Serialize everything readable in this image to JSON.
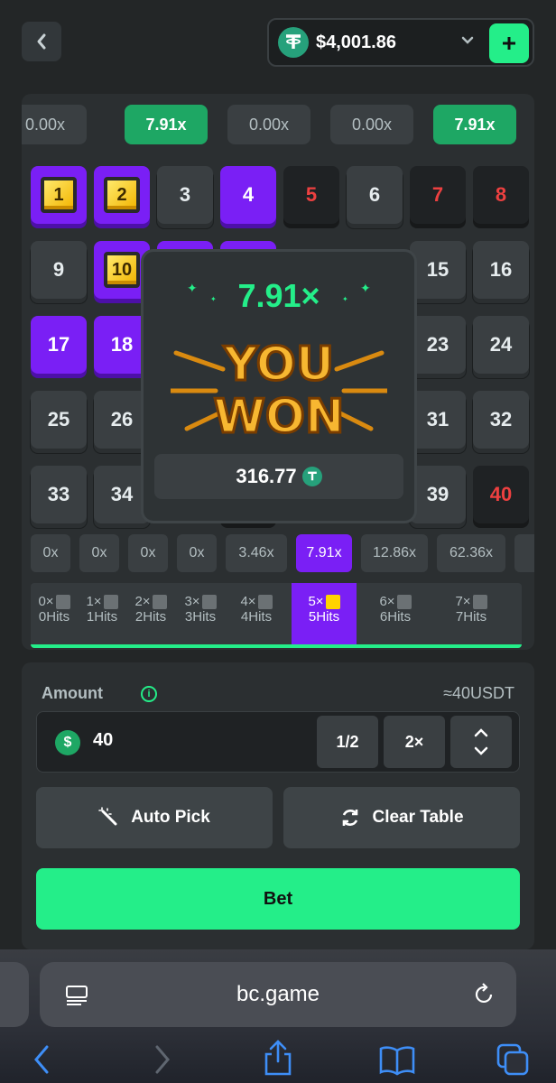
{
  "wallet": {
    "amount": "$4,001.86",
    "currency_icon": "tether-icon"
  },
  "game": {
    "top_multipliers": [
      "0.00x",
      "7.91x",
      "0.00x",
      "0.00x",
      "7.91x"
    ],
    "numbers": [
      "1",
      "2",
      "3",
      "4",
      "5",
      "6",
      "7",
      "8",
      "9",
      "10",
      "15",
      "16",
      "17",
      "18",
      "23",
      "24",
      "25",
      "26",
      "31",
      "32",
      "33",
      "34",
      "39",
      "40"
    ],
    "win": {
      "multiplier": "7.91×",
      "title_line1": "YOU",
      "title_line2": "WON",
      "amount": "316.77"
    },
    "payouts": [
      "0x",
      "0x",
      "0x",
      "0x",
      "3.46x",
      "7.91x",
      "12.86x",
      "62.36x"
    ],
    "hits": [
      {
        "count": "0×",
        "label": "0Hits"
      },
      {
        "count": "1×",
        "label": "1Hits"
      },
      {
        "count": "2×",
        "label": "2Hits"
      },
      {
        "count": "3×",
        "label": "3Hits"
      },
      {
        "count": "4×",
        "label": "4Hits"
      },
      {
        "count": "5×",
        "label": "5Hits"
      },
      {
        "count": "6×",
        "label": "6Hits"
      },
      {
        "count": "7×",
        "label": "7Hits"
      }
    ]
  },
  "controls": {
    "amount_label": "Amount",
    "approx": "≈40USDT",
    "amount_value": "40",
    "half_label": "1/2",
    "double_label": "2×",
    "auto_pick_label": "Auto Pick",
    "clear_table_label": "Clear Table",
    "bet_label": "Bet"
  },
  "browser": {
    "url": "bc.game"
  },
  "colors": {
    "accent": "#24ee89",
    "purple": "#7a1ff5",
    "red": "#ed4040",
    "win_green": "#1ea764"
  }
}
